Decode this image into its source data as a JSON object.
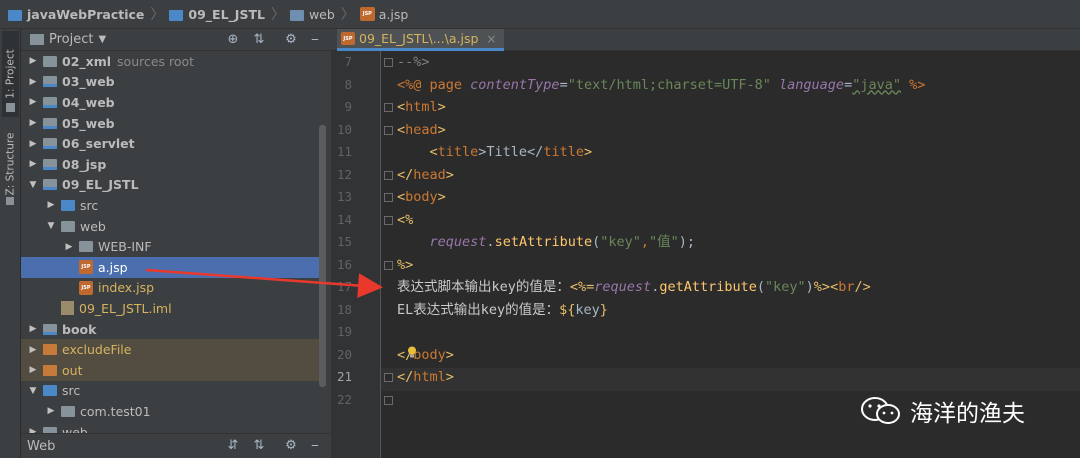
{
  "breadcrumbs": [
    {
      "label": "javaWebPractice",
      "icon": "module-folder-icon"
    },
    {
      "label": "09_EL_JSTL",
      "icon": "module-folder-icon"
    },
    {
      "label": "web",
      "icon": "web-folder-icon"
    },
    {
      "label": "a.jsp",
      "icon": "jsp-file-icon"
    }
  ],
  "side_tabs": {
    "project": "1: Project",
    "structure": "Z: Structure"
  },
  "project_panel": {
    "title": "Project",
    "tree": [
      {
        "label": "02_xml",
        "extra": "sources root",
        "indent": 1,
        "arrow": "right",
        "icon": "folder",
        "bold": true
      },
      {
        "label": "03_web",
        "indent": 1,
        "arrow": "right",
        "icon": "module",
        "bold": true
      },
      {
        "label": "04_web",
        "indent": 1,
        "arrow": "right",
        "icon": "module",
        "bold": true
      },
      {
        "label": "05_web",
        "indent": 1,
        "arrow": "right",
        "icon": "module",
        "bold": true
      },
      {
        "label": "06_servlet",
        "indent": 1,
        "arrow": "right",
        "icon": "module",
        "bold": true
      },
      {
        "label": "08_jsp",
        "indent": 1,
        "arrow": "right",
        "icon": "module",
        "bold": true
      },
      {
        "label": "09_EL_JSTL",
        "indent": 1,
        "arrow": "down",
        "icon": "module",
        "bold": true
      },
      {
        "label": "src",
        "indent": 2,
        "arrow": "right",
        "icon": "src",
        "bold": false
      },
      {
        "label": "web",
        "indent": 2,
        "arrow": "down",
        "icon": "folder",
        "bold": false
      },
      {
        "label": "WEB-INF",
        "indent": 3,
        "arrow": "right",
        "icon": "folder",
        "bold": false
      },
      {
        "label": "a.jsp",
        "indent": 3,
        "arrow": "",
        "icon": "jsp",
        "bold": false,
        "selected": true
      },
      {
        "label": "index.jsp",
        "indent": 3,
        "arrow": "",
        "icon": "jsp",
        "bold": false,
        "orange": true
      },
      {
        "label": "09_EL_JSTL.iml",
        "indent": 2,
        "arrow": "",
        "icon": "iml",
        "bold": false,
        "orange": true
      },
      {
        "label": "book",
        "indent": 1,
        "arrow": "right",
        "icon": "module",
        "bold": true
      },
      {
        "label": "excludeFile",
        "indent": 1,
        "arrow": "right",
        "icon": "excluded",
        "bold": false,
        "excluded": true
      },
      {
        "label": "out",
        "indent": 1,
        "arrow": "right",
        "icon": "excluded",
        "bold": false,
        "excluded": true
      },
      {
        "label": "src",
        "indent": 1,
        "arrow": "down",
        "icon": "src",
        "bold": false
      },
      {
        "label": "com.test01",
        "indent": 2,
        "arrow": "right",
        "icon": "package",
        "bold": false
      },
      {
        "label": "web",
        "indent": 1,
        "arrow": "right",
        "icon": "folder",
        "bold": false
      }
    ]
  },
  "bottom_panel": {
    "title": "Web"
  },
  "editor": {
    "tab_label": "09_EL_JSTL\\...\\a.jsp",
    "current_line": "21",
    "lines": [
      {
        "no": "7"
      },
      {
        "no": "8"
      },
      {
        "no": "9"
      },
      {
        "no": "10"
      },
      {
        "no": "11"
      },
      {
        "no": "12"
      },
      {
        "no": "13"
      },
      {
        "no": "14"
      },
      {
        "no": "15"
      },
      {
        "no": "16"
      },
      {
        "no": "17"
      },
      {
        "no": "18"
      },
      {
        "no": "19"
      },
      {
        "no": "20"
      },
      {
        "no": "21"
      },
      {
        "no": "22"
      }
    ],
    "code": {
      "l7_comment": "--%>",
      "l8_open": "<%@ ",
      "l8_page": "page ",
      "l8_attr1": "contentType",
      "l8_eq1": "=",
      "l8_val1": "\"text/html;charset=UTF-8\"",
      "l8_attr2": " language",
      "l8_eq2": "=",
      "l8_val2": "\"java\"",
      "l8_close": " %>",
      "l9_open": "<",
      "l9_tag": "html",
      "l9_close": ">",
      "l10_open": "<",
      "l10_tag": "head",
      "l10_close": ">",
      "l11_indent": "    <",
      "l11_tag1": "title",
      "l11_mid": ">Title</",
      "l11_tag2": "title",
      "l11_close": ">",
      "l12_open": "</",
      "l12_tag": "head",
      "l12_close": ">",
      "l13_open": "<",
      "l13_tag": "body",
      "l13_close": ">",
      "l14_scriptlet": "<%",
      "l15_indent": "    ",
      "l15_obj": "request",
      "l15_dot": ".",
      "l15_fn": "setAttribute",
      "l15_args_open": "(",
      "l15_arg1": "\"key\"",
      "l15_comma": ",",
      "l15_arg2": "\"值\"",
      "l15_args_close": ");",
      "l16_scriptlet": "%>",
      "l17_text": "表达式脚本输出key的值是：",
      "l17_open": "<%=",
      "l17_obj": "request",
      "l17_dot": ".",
      "l17_fn": "getAttribute",
      "l17_args_open": "(",
      "l17_arg": "\"key\"",
      "l17_args_close": ")",
      "l17_close": "%>",
      "l17_br_open": "<",
      "l17_br": "br",
      "l17_br_close": "/>",
      "l18_text": "EL表达式输出key的值是：",
      "l18_el_open": "${",
      "l18_el_key": "key",
      "l18_el_close": "}",
      "l20_open": "</",
      "l20_tag": "body",
      "l20_close": ">",
      "l21_open": "</",
      "l21_tag": "html",
      "l21_close": ">"
    }
  },
  "watermark": {
    "text": "海洋的渔夫"
  }
}
